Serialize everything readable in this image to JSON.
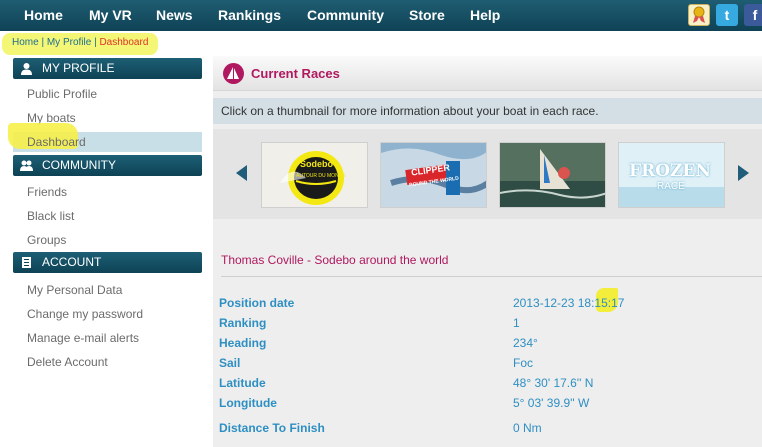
{
  "nav": {
    "items": [
      "Home",
      "My VR",
      "News",
      "Rankings",
      "Community",
      "Store",
      "Help"
    ]
  },
  "social": {
    "icons": [
      "award-icon",
      "twitter-icon",
      "facebook-icon"
    ],
    "twitter_glyph": "t",
    "facebook_glyph": "f"
  },
  "breadcrumb": {
    "home": "Home",
    "sep1": " | ",
    "profile": "My Profile",
    "sep2": " | ",
    "current": "Dashboard"
  },
  "sidebar": {
    "profile_header": "MY PROFILE",
    "profile_items": [
      "Public Profile",
      "My boats",
      "Dashboard"
    ],
    "community_header": "COMMUNITY",
    "community_items": [
      "Friends",
      "Black list",
      "Groups"
    ],
    "account_header": "ACCOUNT",
    "account_items": [
      "My Personal Data",
      "Change my password",
      "Manage e-mail alerts",
      "Delete Account"
    ]
  },
  "main": {
    "title": "Current Races",
    "instructions": "Click on a thumbnail for more information about your boat in each race.",
    "thumbnails": [
      {
        "name": "Sodebo Autour du Monde",
        "text1": "Sodebo",
        "text2": "AUTOUR DU MONDE"
      },
      {
        "name": "Clipper Round the World 13-14",
        "text1": "CLIPPER",
        "text2": "ROUND THE WORLD"
      },
      {
        "name": "Sailing race",
        "text1": "",
        "text2": ""
      },
      {
        "name": "Frozen Race",
        "text1": "FROZEN",
        "text2": "RACE"
      }
    ],
    "race_name": "Thomas Coville - Sodebo around the world",
    "details": [
      {
        "label": "Position date",
        "value": "2013-12-23 18:15:17"
      },
      {
        "label": "Ranking",
        "value": "1"
      },
      {
        "label": "Heading",
        "value": "234°"
      },
      {
        "label": "Sail",
        "value": "Foc"
      },
      {
        "label": "Latitude",
        "value": "48° 30' 17.6'' N"
      },
      {
        "label": "Longitude",
        "value": "5° 03' 39.9'' W"
      },
      {
        "label": "Distance To Finish",
        "value": "0 Nm"
      }
    ]
  },
  "colors": {
    "nav_bg": "#0f4256",
    "accent_magenta": "#b0185f",
    "link_blue": "#2e8fc3",
    "highlight_yellow": "#f4f776"
  }
}
